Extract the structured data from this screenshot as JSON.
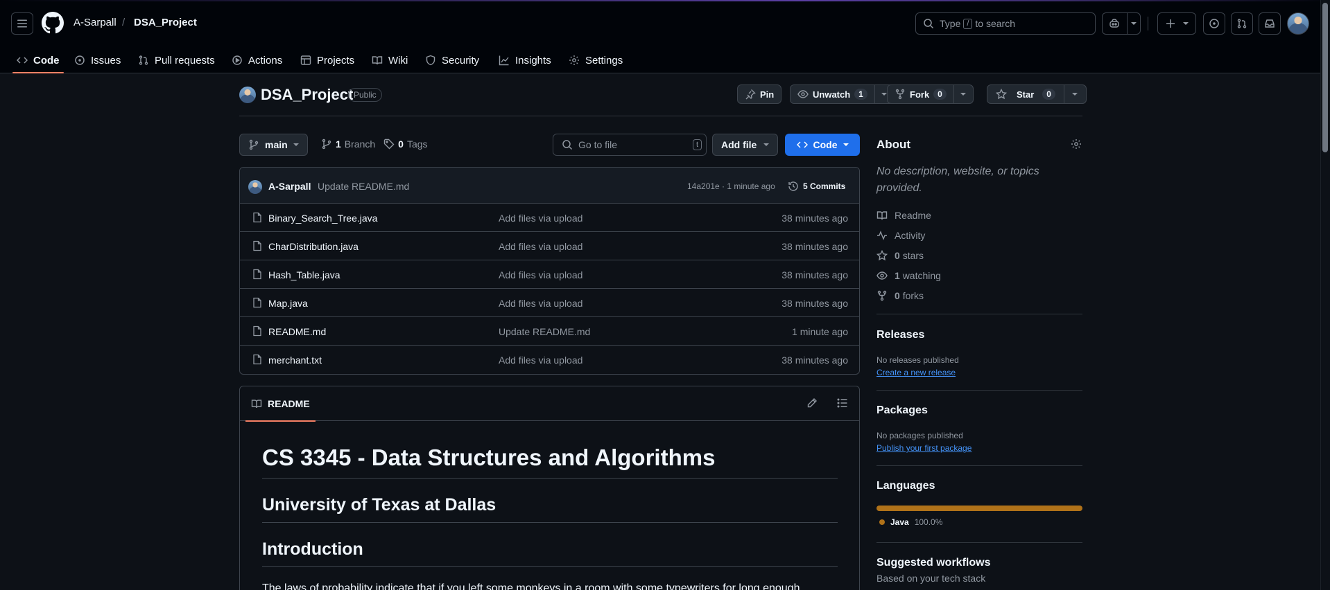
{
  "header": {
    "owner": "A-Sarpall",
    "separator": "/",
    "repo": "DSA_Project",
    "search_prefix": "Type",
    "search_key": "/",
    "search_suffix": "to search"
  },
  "nav": {
    "tabs": [
      {
        "label": "Code",
        "icon": "code-icon",
        "selected": true
      },
      {
        "label": "Issues",
        "icon": "issue-opened-icon"
      },
      {
        "label": "Pull requests",
        "icon": "git-pull-request-icon"
      },
      {
        "label": "Actions",
        "icon": "play-icon"
      },
      {
        "label": "Projects",
        "icon": "table-icon"
      },
      {
        "label": "Wiki",
        "icon": "book-icon"
      },
      {
        "label": "Security",
        "icon": "shield-icon"
      },
      {
        "label": "Insights",
        "icon": "graph-icon"
      },
      {
        "label": "Settings",
        "icon": "gear-icon"
      }
    ]
  },
  "repo": {
    "title": "DSA_Project",
    "visibility": "Public",
    "pin_label": "Pin",
    "unwatch_label": "Unwatch",
    "watch_count": "1",
    "fork_label": "Fork",
    "fork_count": "0",
    "star_label": "Star",
    "star_count": "0"
  },
  "filenav": {
    "branch": "main",
    "branch_count": "1",
    "branch_label": "Branch",
    "tag_count": "0",
    "tag_label": "Tags",
    "goto_placeholder": "Go to file",
    "goto_key": "t",
    "add_file_label": "Add file",
    "code_label": "Code"
  },
  "commit": {
    "author": "A-Sarpall",
    "message": "Update README.md",
    "meta": "14a201e · 1 minute ago",
    "count_label": "5 Commits"
  },
  "files": [
    {
      "name": "Binary_Search_Tree.java",
      "message": "Add files via upload",
      "time": "38 minutes ago"
    },
    {
      "name": "CharDistribution.java",
      "message": "Add files via upload",
      "time": "38 minutes ago"
    },
    {
      "name": "Hash_Table.java",
      "message": "Add files via upload",
      "time": "38 minutes ago"
    },
    {
      "name": "Map.java",
      "message": "Add files via upload",
      "time": "38 minutes ago"
    },
    {
      "name": "README.md",
      "message": "Update README.md",
      "time": "1 minute ago"
    },
    {
      "name": "merchant.txt",
      "message": "Add files via upload",
      "time": "38 minutes ago"
    }
  ],
  "readme": {
    "tab_label": "README",
    "h1": "CS 3345 - Data Structures and Algorithms",
    "h2a": "University of Texas at Dallas",
    "h2b": "Introduction",
    "p1": "The laws of probability indicate that if you left some monkeys in a room with some typewriters for long enough,"
  },
  "about": {
    "title": "About",
    "description": "No description, website, or topics provided.",
    "readme": "Readme",
    "activity": "Activity",
    "stars_count": "0",
    "stars_label": "stars",
    "watching_count": "1",
    "watching_label": "watching",
    "forks_count": "0",
    "forks_label": "forks"
  },
  "releases": {
    "title": "Releases",
    "empty": "No releases published",
    "link": "Create a new release"
  },
  "packages": {
    "title": "Packages",
    "empty": "No packages published",
    "link": "Publish your first package"
  },
  "languages": {
    "title": "Languages",
    "items": [
      {
        "name": "Java",
        "percent": "100.0%",
        "fraction": 1.0,
        "color": "#b07219"
      }
    ]
  },
  "workflows": {
    "title": "Suggested workflows",
    "subtitle": "Based on your tech stack"
  },
  "colors": {
    "accent_underline": "#f78166",
    "code_button": "#1f6feb",
    "link": "#4493f8"
  }
}
